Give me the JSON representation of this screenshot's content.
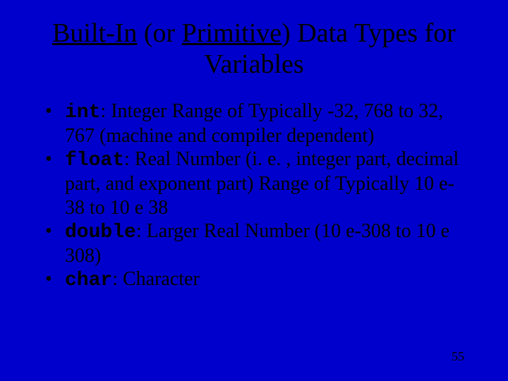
{
  "title": {
    "part1": "Built-In",
    "part2": " (or ",
    "part3": "Primitive",
    "part4": ") Data Types for Variables"
  },
  "bullets": {
    "b1_kw": "int",
    "b1_rest": ": Integer Range of Typically -32, 768 to 32, 767 (machine and compiler dependent)",
    "b2_kw": "float",
    "b2_rest": ": Real Number (i. e. , integer part, decimal part, and exponent part) Range of Typically 10 e-38 to 10 e 38",
    "b3_kw": "double",
    "b3_rest": ": Larger Real Number (10 e-308 to 10 e 308)",
    "b4_kw": "char",
    "b4_rest": ":  Character"
  },
  "page": "55",
  "dot": "•"
}
